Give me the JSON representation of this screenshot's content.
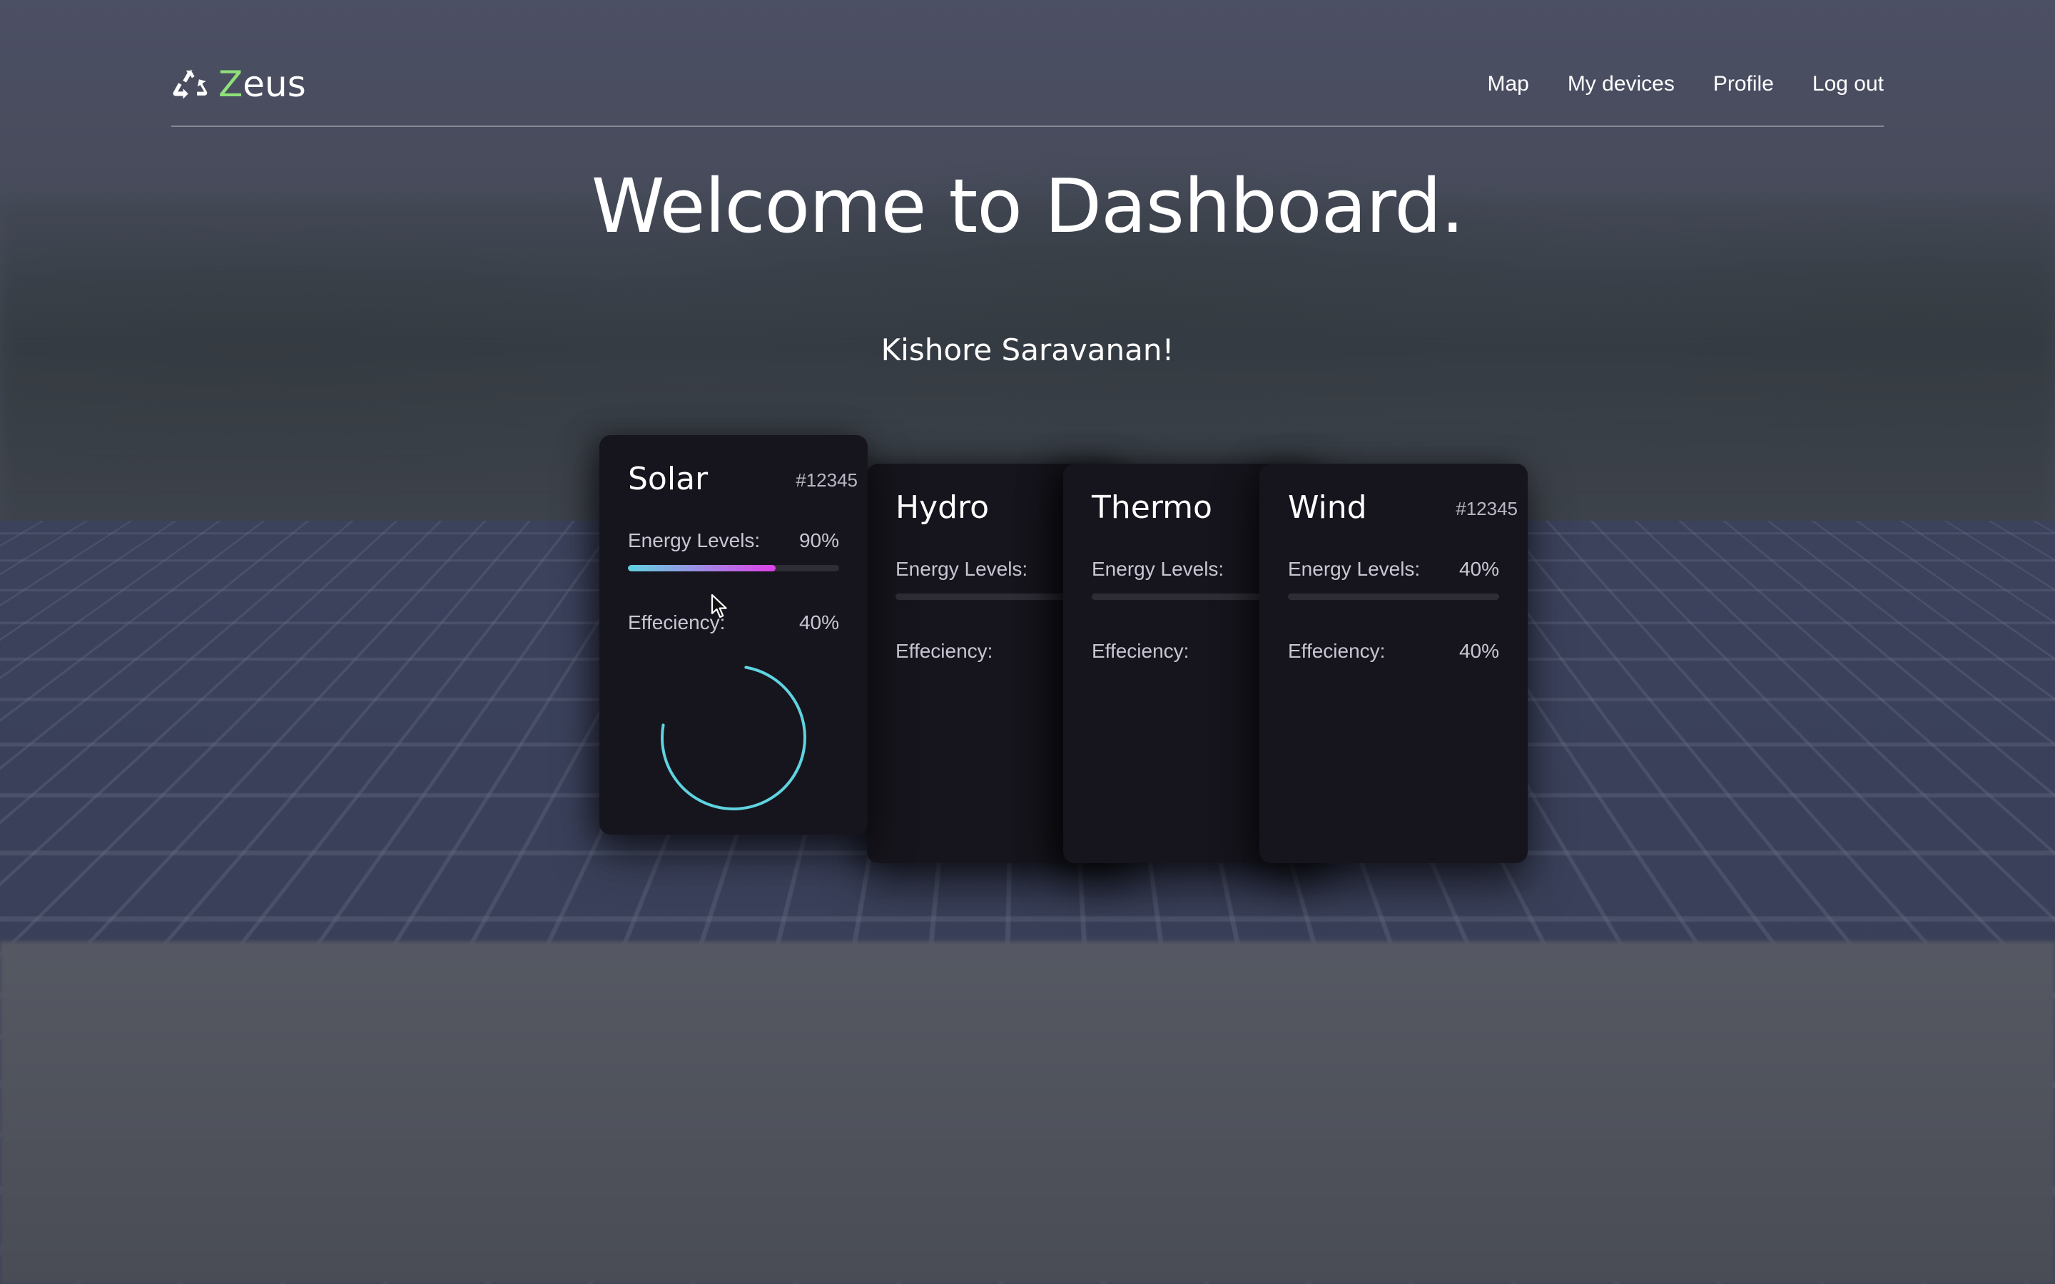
{
  "brand": {
    "initial": "Z",
    "rest": "eus",
    "accent_color": "#8fe07a",
    "icon": "recycle-icon"
  },
  "nav": {
    "items": [
      "Map",
      "My devices",
      "Profile",
      "Log out"
    ]
  },
  "hero": {
    "title": "Welcome to Dashboard.",
    "subtitle": "Kishore Saravanan!"
  },
  "cards": {
    "solar": {
      "title": "Solar",
      "id": "#12345",
      "energy_label": "Energy Levels:",
      "energy_value": "90%",
      "energy_fraction": 0.7,
      "efficiency_label": "Effeciency:",
      "efficiency_value": "40%",
      "ring_fraction": 0.75
    },
    "hydro": {
      "title": "Hydro",
      "id": "#",
      "energy_label": "Energy Levels:",
      "efficiency_label": "Effeciency:"
    },
    "thermo": {
      "title": "Thermo",
      "id": "#",
      "energy_label": "Energy Levels:",
      "efficiency_label": "Effeciency:"
    },
    "wind": {
      "title": "Wind",
      "id": "#12345",
      "energy_label": "Energy Levels:",
      "energy_value": "40%",
      "efficiency_label": "Effeciency:",
      "efficiency_value": "40%"
    }
  },
  "colors": {
    "card_bg": "#16151d",
    "bar_start": "#5fd3e0",
    "bar_end": "#e040e8",
    "ring": "#5fd3e0",
    "track": "#2e2d36"
  }
}
